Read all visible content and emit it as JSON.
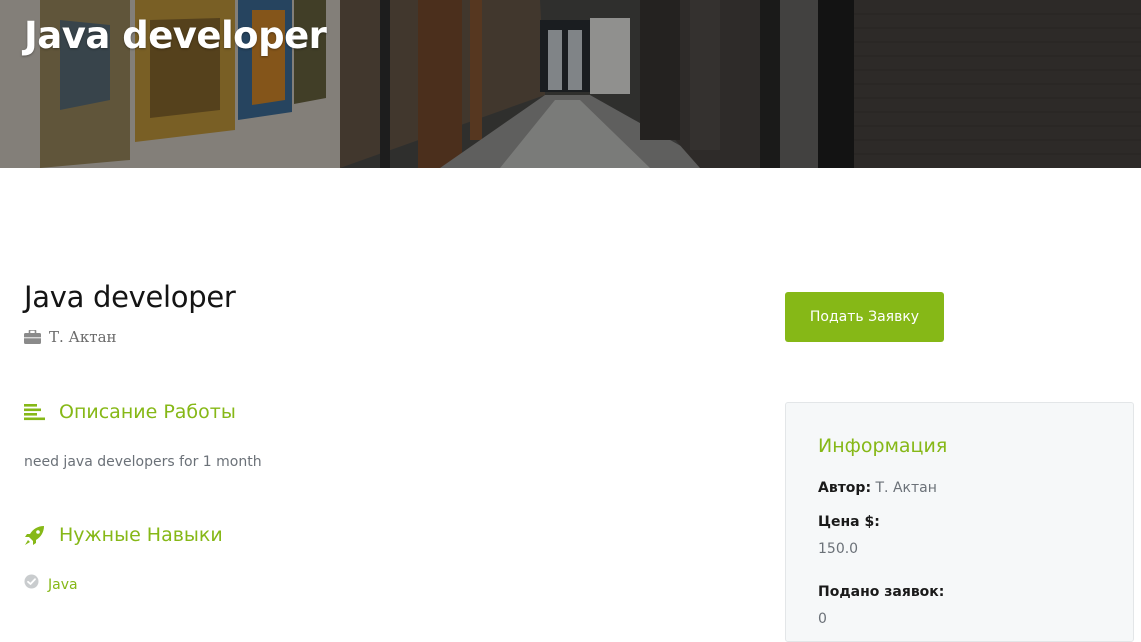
{
  "hero": {
    "title": "Java developer"
  },
  "job": {
    "title": "Java developer",
    "author": "Т.  Актан",
    "author_icon": "briefcase-icon"
  },
  "description": {
    "heading": "Описание Работы",
    "icon": "align-left-icon",
    "text": "need java developers for 1 month"
  },
  "skills": {
    "heading": "Нужные Навыки",
    "icon": "rocket-icon",
    "items": [
      {
        "label": "Java",
        "icon": "check-circle-icon"
      }
    ]
  },
  "apply": {
    "label": "Подать Заявку"
  },
  "info": {
    "title": "Информация",
    "author_label": "Автор:",
    "author_value": "Т. Актан",
    "price_label": "Цена $:",
    "price_value": "150.0",
    "applications_label": "Подано заявок:",
    "applications_value": "0"
  },
  "colors": {
    "accent": "#86b817",
    "text_dark": "#141414",
    "text_muted": "#6b7178",
    "card_bg": "#f6f8f9"
  }
}
